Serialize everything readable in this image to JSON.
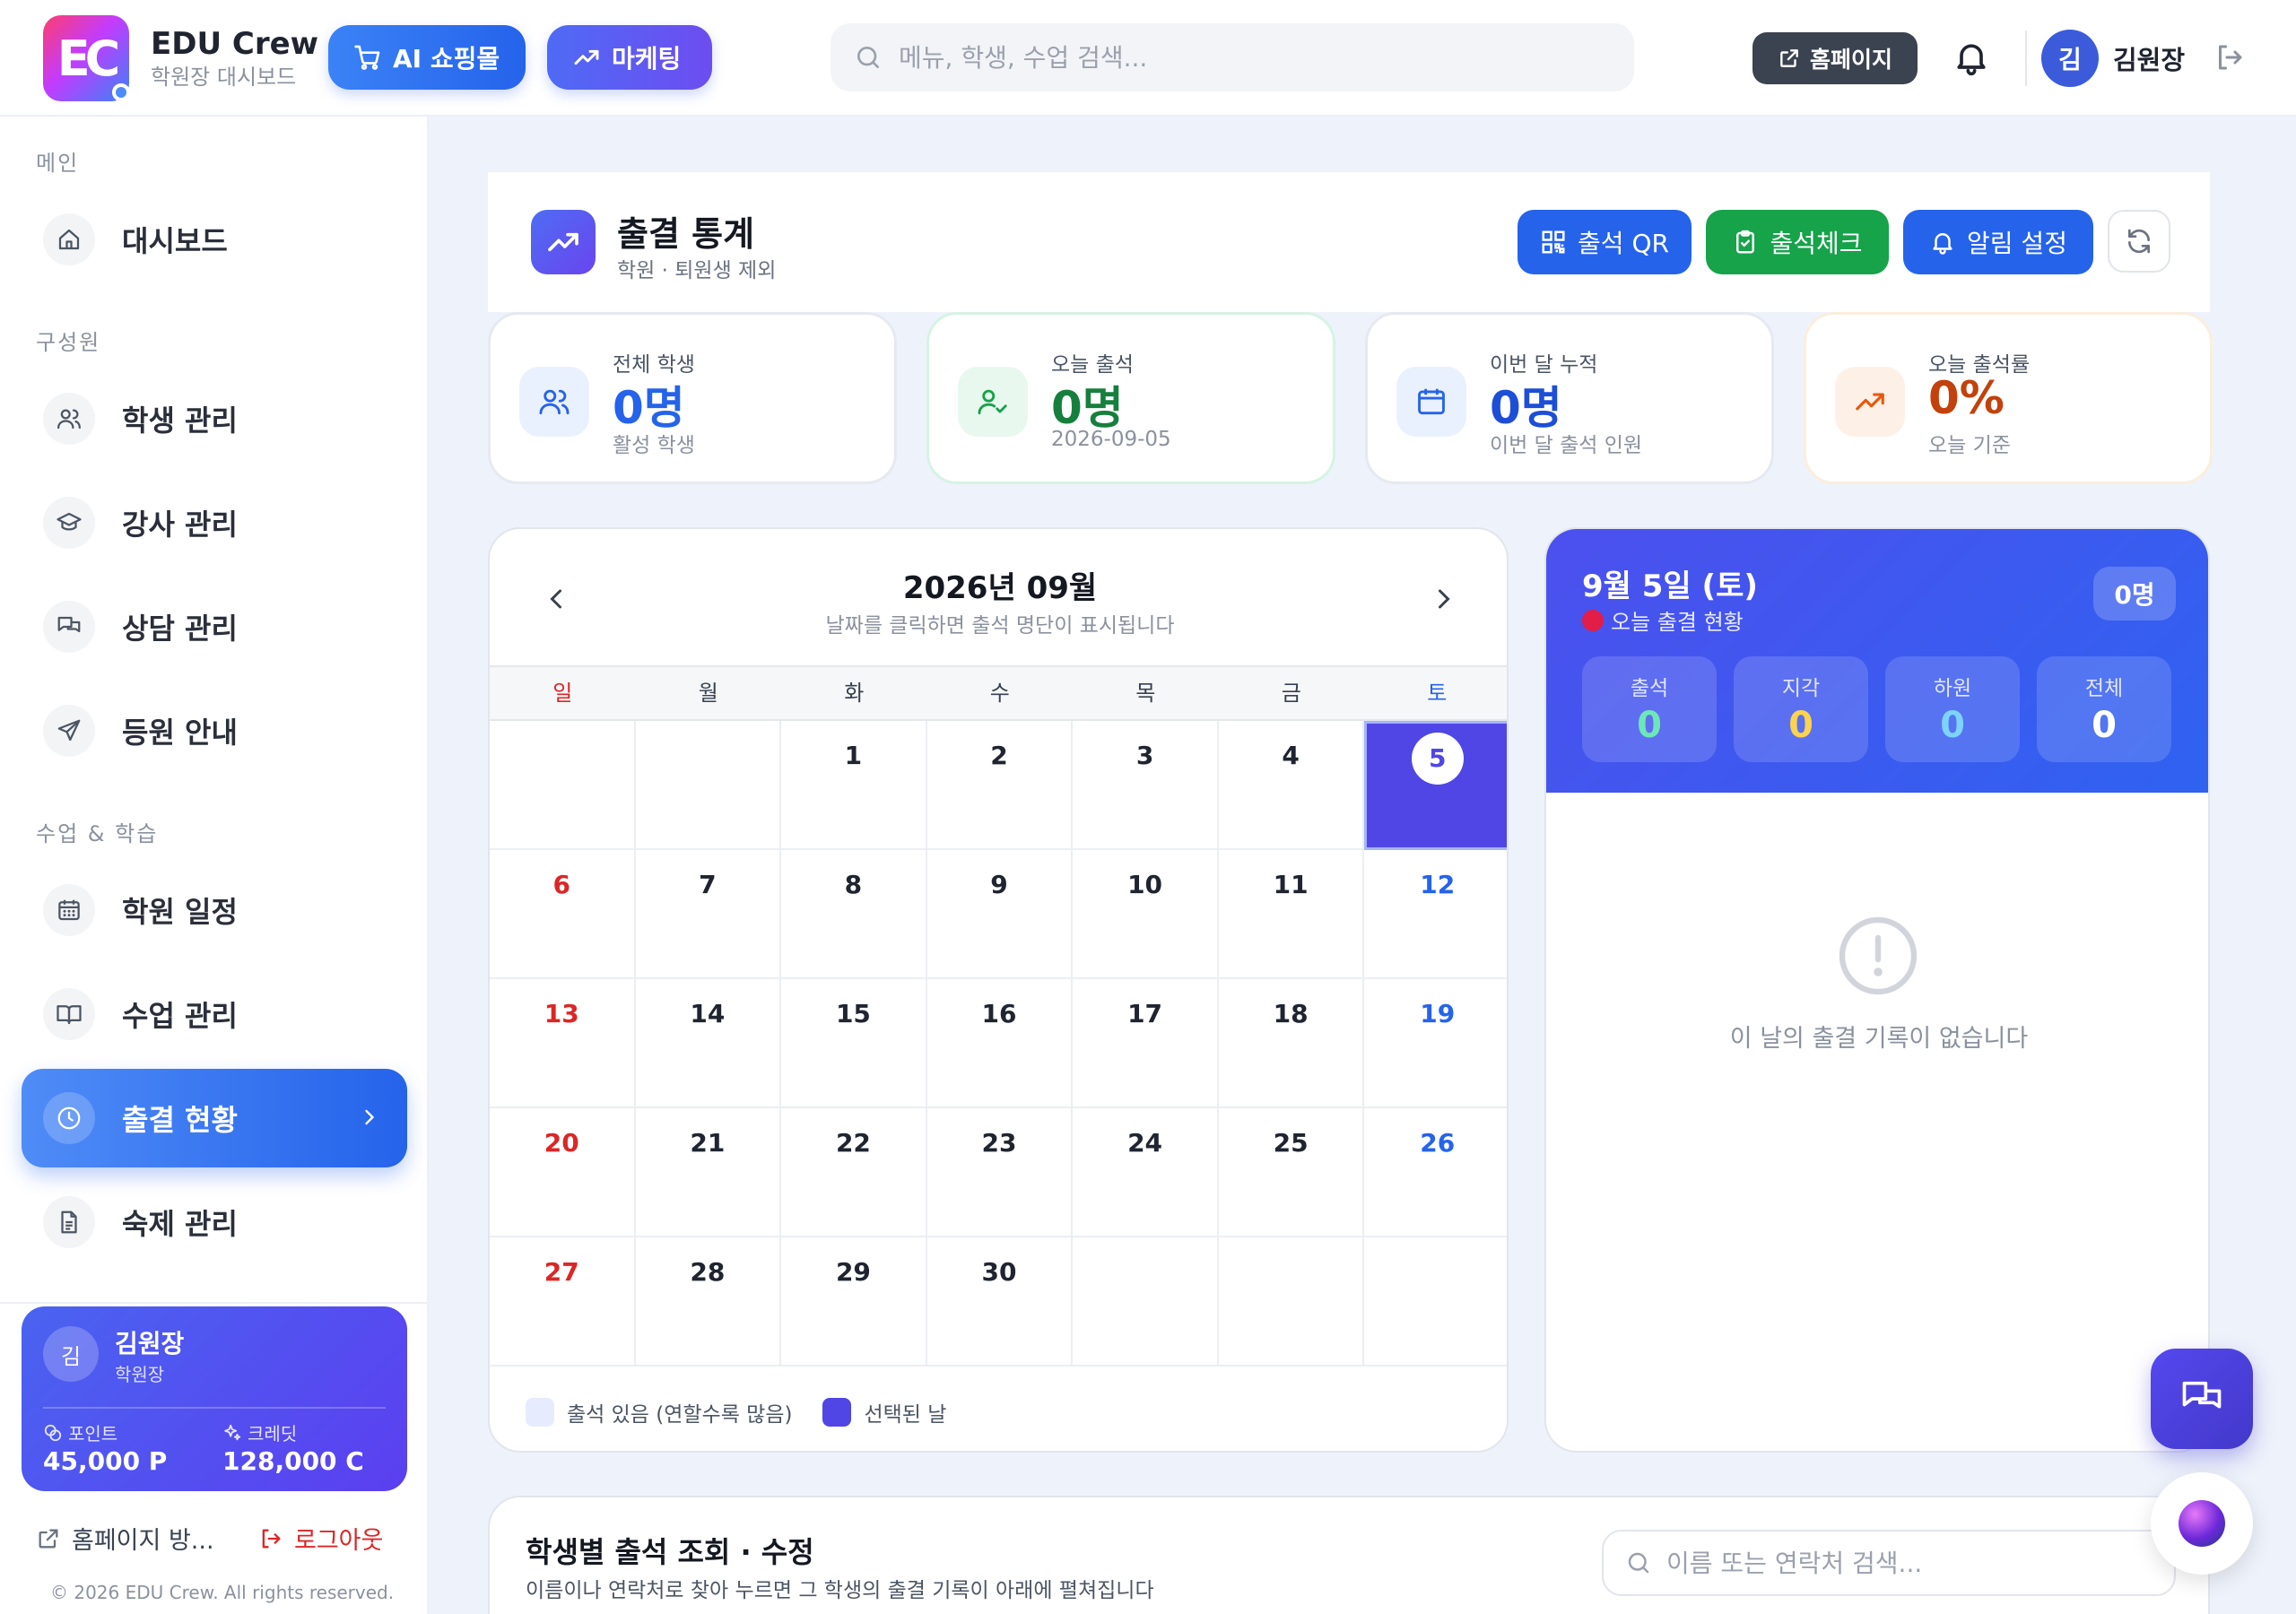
{
  "header": {
    "logo_text": "EC",
    "brand_name": "EDU Crew",
    "brand_sub": "학원장 대시보드",
    "shop_label": "AI 쇼핑몰",
    "marketing_label": "마케팅",
    "search_placeholder": "메뉴, 학생, 수업 검색...",
    "homepage_label": "홈페이지",
    "avatar_initial": "김",
    "user_name": "김원장"
  },
  "sidebar": {
    "sections": {
      "main": "메인",
      "members": "구성원",
      "classes": "수업 & 학습"
    },
    "items": [
      {
        "label": "대시보드"
      },
      {
        "label": "학생 관리"
      },
      {
        "label": "강사 관리"
      },
      {
        "label": "상담 관리"
      },
      {
        "label": "등원 안내"
      },
      {
        "label": "학원 일정"
      },
      {
        "label": "수업 관리"
      },
      {
        "label": "출결 현황"
      },
      {
        "label": "숙제 관리"
      }
    ],
    "profile": {
      "initial": "김",
      "name": "김원장",
      "role": "학원장",
      "points_label": "포인트",
      "points_value": "45,000 P",
      "credit_label": "크레딧",
      "credit_value": "128,000 C"
    },
    "homepage_link": "홈페이지 방...",
    "logout": "로그아웃",
    "copyright": "© 2026 EDU Crew. All rights reserved."
  },
  "title": {
    "heading": "출결 통계",
    "sub": "학원 · 퇴원생 제외",
    "qr_label": "출석 QR",
    "check_label": "출석체크",
    "alarm_label": "알림 설정"
  },
  "stats": [
    {
      "label": "전체 학생",
      "value": "0명",
      "note": "활성 학생"
    },
    {
      "label": "오늘 출석",
      "value": "0명",
      "note": "2026-09-05"
    },
    {
      "label": "이번 달 누적",
      "value": "0명",
      "note": "이번 달 출석 인원"
    },
    {
      "label": "오늘 출석률",
      "value": "0%",
      "note": "오늘 기준"
    }
  ],
  "calendar": {
    "title": "2026년 09월",
    "sub": "날짜를 클릭하면 출석 명단이 표시됩니다",
    "weekdays": [
      "일",
      "월",
      "화",
      "수",
      "목",
      "금",
      "토"
    ],
    "first_weekday": 2,
    "days_in_month": 30,
    "selected_day": 5,
    "legend_has": "출석 있음 (연할수록 많음)",
    "legend_selected": "선택된 날"
  },
  "detail": {
    "date": "9월 5일 (토)",
    "sub": "오늘 출결 현황",
    "badge": "0명",
    "boxes": [
      {
        "label": "출석",
        "value": "0"
      },
      {
        "label": "지각",
        "value": "0"
      },
      {
        "label": "하원",
        "value": "0"
      },
      {
        "label": "전체",
        "value": "0"
      }
    ],
    "empty_text": "이 날의 출결 기록이 없습니다"
  },
  "student": {
    "title": "학생별 출석 조회 · 수정",
    "sub": "이름이나 연락처로 찾아 누르면 그 학생의 출결 기록이 아래에 펼쳐집니다",
    "search_placeholder": "이름 또는 연락처 검색..."
  },
  "colors": {
    "primary": "#2563eb",
    "indigo": "#4f46e5",
    "green": "#16a34a",
    "stat_blue": "#2563eb",
    "stat_green": "#15803d",
    "stat_indigo": "#1d4ed8",
    "stat_orange": "#c2410c"
  }
}
